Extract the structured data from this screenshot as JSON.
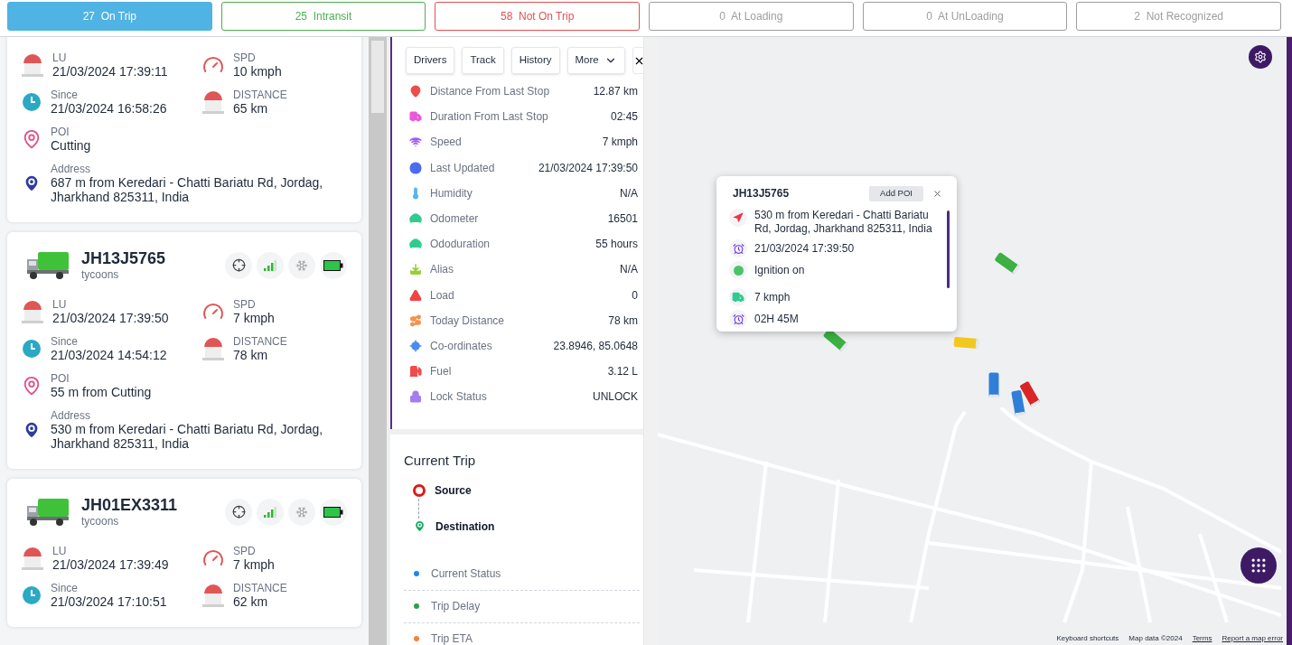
{
  "status_tabs": [
    {
      "count": "27",
      "label": "On Trip",
      "selected": true,
      "color": "#4fb3e3"
    },
    {
      "count": "25",
      "label": "Intransit",
      "selected": false,
      "color": "#4caf50"
    },
    {
      "count": "58",
      "label": "Not On Trip",
      "selected": false,
      "color": "#e05252"
    },
    {
      "count": "0",
      "label": "At Loading",
      "selected": false,
      "color": "#9e9e9e"
    },
    {
      "count": "0",
      "label": "At UnLoading",
      "selected": false,
      "color": "#9e9e9e"
    },
    {
      "count": "2",
      "label": "Not Recognized",
      "selected": false,
      "color": "#9e9e9e"
    }
  ],
  "vehicles": [
    {
      "metrics": [
        {
          "kind": "lu",
          "label": "LU",
          "value": "21/03/2024 17:39:11"
        },
        {
          "kind": "spd",
          "label": "SPD",
          "value": "10 kmph"
        },
        {
          "kind": "since",
          "label": "Since",
          "value": "21/03/2024 16:58:26"
        },
        {
          "kind": "distance",
          "label": "DISTANCE",
          "value": "65 km"
        },
        {
          "kind": "poi",
          "label": "POI",
          "value": "Cutting"
        },
        {
          "kind": "address",
          "label": "Address",
          "value": "687 m from Keredari - Chatti Bariatu Rd, Jordag, Jharkhand 825311, India"
        }
      ]
    },
    {
      "name": "JH13J5765",
      "group": "tycoons",
      "metrics": [
        {
          "kind": "lu",
          "label": "LU",
          "value": "21/03/2024 17:39:50"
        },
        {
          "kind": "spd",
          "label": "SPD",
          "value": "7 kmph"
        },
        {
          "kind": "since",
          "label": "Since",
          "value": "21/03/2024 14:54:12"
        },
        {
          "kind": "distance",
          "label": "DISTANCE",
          "value": "78 km"
        },
        {
          "kind": "poi",
          "label": "POI",
          "value": "55 m from Cutting"
        },
        {
          "kind": "address",
          "label": "Address",
          "value": "530 m from Keredari - Chatti Bariatu Rd, Jordag, Jharkhand 825311, India"
        }
      ]
    },
    {
      "name": "JH01EX3311",
      "group": "tycoons",
      "metrics": [
        {
          "kind": "lu",
          "label": "LU",
          "value": "21/03/2024 17:39:49"
        },
        {
          "kind": "spd",
          "label": "SPD",
          "value": "7 kmph"
        },
        {
          "kind": "since",
          "label": "Since",
          "value": "21/03/2024 17:10:51"
        },
        {
          "kind": "distance",
          "label": "DISTANCE",
          "value": "62 km"
        }
      ]
    }
  ],
  "detail": {
    "buttons": [
      "Drivers",
      "Track",
      "History"
    ],
    "more": "More",
    "rows": [
      {
        "kind": "pin",
        "color": "#f04b4b",
        "label": "Distance From Last Stop",
        "value": "12.87 km"
      },
      {
        "kind": "truck",
        "color": "#e85ad8",
        "label": "Duration From Last Stop",
        "value": "02:45"
      },
      {
        "kind": "wifi",
        "color": "#a35cf0",
        "label": "Speed",
        "value": "7 kmph"
      },
      {
        "kind": "info",
        "color": "#4b6cf0",
        "label": "Last Updated",
        "value": "21/03/2024 17:39:50"
      },
      {
        "kind": "thermo",
        "color": "#5ab4f0",
        "label": "Humidity",
        "value": "N/A"
      },
      {
        "kind": "odometer",
        "color": "#2ecc8f",
        "label": "Odometer",
        "value": "16501"
      },
      {
        "kind": "odometer",
        "color": "#2ecc8f",
        "label": "Ododuration",
        "value": "55 hours"
      },
      {
        "kind": "download",
        "color": "#9acd32",
        "label": "Alias",
        "value": "N/A"
      },
      {
        "kind": "alert",
        "color": "#f04444",
        "label": "Load",
        "value": "0"
      },
      {
        "kind": "route",
        "color": "#f5914b",
        "label": "Today Distance",
        "value": "78 km"
      },
      {
        "kind": "locate",
        "color": "#4b8cf0",
        "label": "Co-ordinates",
        "value": "23.8946, 85.0648"
      },
      {
        "kind": "fuel",
        "color": "#f04b4b",
        "label": "Fuel",
        "value": "3.12 L"
      },
      {
        "kind": "lock",
        "color": "#a37cf0",
        "label": "Lock Status",
        "value": "UNLOCK"
      }
    ]
  },
  "current_trip": {
    "title": "Current Trip",
    "source": "Source",
    "destination": "Destination",
    "statuses": [
      {
        "label": "Current Status",
        "color": "#1e88e5"
      },
      {
        "label": "Trip Delay",
        "color": "#2e9e4f"
      },
      {
        "label": "Trip ETA",
        "color": "#f5813b"
      }
    ]
  },
  "map": {
    "markers": [
      {
        "color": "#3cb043"
      },
      {
        "color": "#3cb043"
      },
      {
        "color": "#f2c81f"
      },
      {
        "color": "#2f7fd8"
      },
      {
        "color": "#2f7fd8"
      },
      {
        "color": "#d92525"
      }
    ],
    "popup": {
      "title": "JH13J5765",
      "add_button": "Add POI",
      "rows": [
        {
          "kind": "address",
          "text": "530 m from Keredari - Chatti Bariatu Rd, Jordag, Jharkhand 825311, India"
        },
        {
          "kind": "time",
          "text": "21/03/2024 17:39:50"
        },
        {
          "kind": "ignition",
          "text": "Ignition on"
        },
        {
          "kind": "speed",
          "text": "7 kmph"
        },
        {
          "kind": "duration",
          "text": "02H 45M"
        }
      ]
    },
    "attribution": [
      {
        "kind": "text",
        "text": "Keyboard shortcuts"
      },
      {
        "kind": "text",
        "text": "Map data ©2024"
      },
      {
        "kind": "link",
        "text": "Terms"
      },
      {
        "kind": "link",
        "text": "Report a map error"
      }
    ]
  }
}
